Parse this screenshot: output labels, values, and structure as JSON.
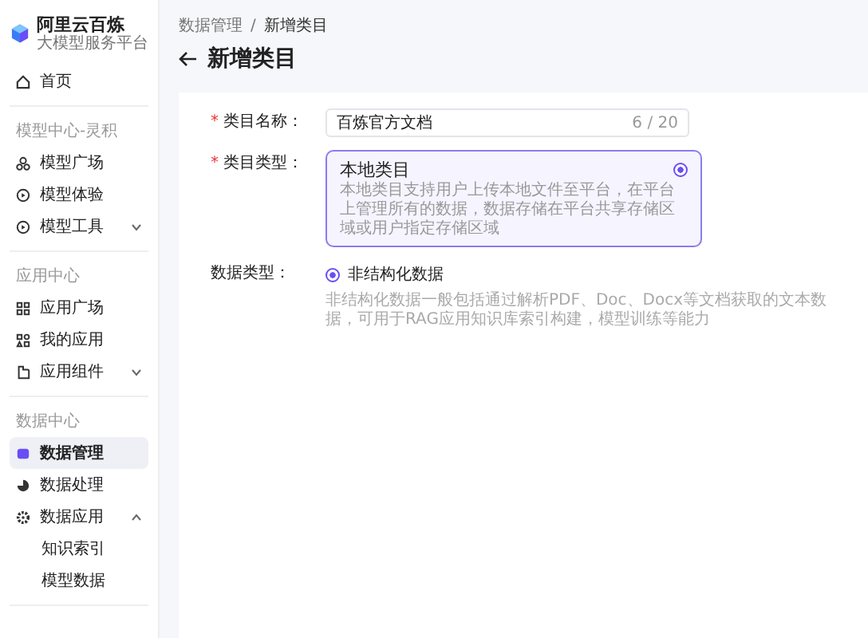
{
  "logo": {
    "title": "阿里云百炼",
    "subtitle": "大模型服务平台"
  },
  "sidebar": {
    "groups": [
      {
        "items": [
          {
            "label": "首页",
            "selected": false
          }
        ]
      },
      {
        "title": "模型中心-灵积",
        "items": [
          {
            "label": "模型广场",
            "selected": false
          },
          {
            "label": "模型体验",
            "selected": false
          },
          {
            "label": "模型工具",
            "selected": false,
            "expanded": false
          }
        ]
      },
      {
        "title": "应用中心",
        "items": [
          {
            "label": "应用广场",
            "selected": false
          },
          {
            "label": "我的应用",
            "selected": false
          },
          {
            "label": "应用组件",
            "selected": false,
            "expanded": false
          }
        ]
      },
      {
        "title": "数据中心",
        "items": [
          {
            "label": "数据管理",
            "selected": true
          },
          {
            "label": "数据处理",
            "selected": false
          },
          {
            "label": "数据应用",
            "selected": false,
            "expanded": true,
            "children": [
              {
                "label": "知识索引",
                "selected": false
              },
              {
                "label": "模型数据",
                "selected": false
              }
            ]
          }
        ]
      }
    ]
  },
  "breadcrumb": {
    "items": [
      "数据管理",
      "新增类目"
    ],
    "separator": "/"
  },
  "page_title": "新增类目",
  "form": {
    "name": {
      "label": "类目名称：",
      "required_mark": "*",
      "value": "百炼官方文档",
      "counter": "6 / 20"
    },
    "type": {
      "label": "类目类型：",
      "required_mark": "*",
      "options": [
        {
          "title": "本地类目",
          "description": "本地类目支持用户上传本地文件至平台，在平台上管理所有的数据，数据存储在平台共享存储区域或用户指定存储区域",
          "selected": true
        }
      ]
    },
    "data_type": {
      "label": "数据类型：",
      "options": [
        {
          "label": "非结构化数据",
          "selected": true
        }
      ],
      "hint": "非结构化数据一般包括通过解析PDF、Doc、Docx等文档获取的文本数据，可用于RAG应用知识库索引构建，模型训练等能力"
    }
  }
}
